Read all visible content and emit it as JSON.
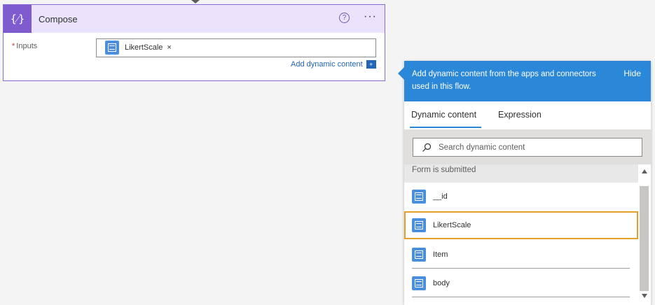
{
  "compose": {
    "title": "Compose",
    "icon_glyph": "{⁄}",
    "icon": "compose-braces-icon",
    "help_glyph": "?",
    "more_glyph": "···",
    "inputs_required_marker": "*",
    "inputs_label": "Inputs",
    "token_label": "LikertScale",
    "token_remove_glyph": "×",
    "add_dynamic_label": "Add dynamic content",
    "add_dynamic_glyph": "+"
  },
  "flyout": {
    "header_text": "Add dynamic content from the apps and connectors used in this flow.",
    "hide_label": "Hide",
    "tabs": [
      "Dynamic content",
      "Expression"
    ],
    "search_placeholder": "Search dynamic content",
    "section_label": "Form is submitted",
    "items": [
      "__id",
      "LikertScale",
      "Item",
      "body"
    ],
    "highlighted_item": "LikertScale"
  },
  "colors": {
    "compose_accent": "#7e5ccf",
    "flyout_header": "#2b88d8",
    "highlight_outline": "#e5a028",
    "link": "#2266b8"
  }
}
